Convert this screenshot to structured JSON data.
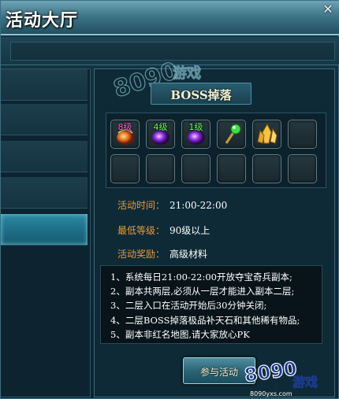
{
  "window": {
    "title": "活动大厅",
    "close_glyph": "✕"
  },
  "boss_drop": {
    "title": "BOSS掉落",
    "items": [
      {
        "level_label": "8级",
        "level_color": "#ff66cc",
        "icon": "orange-gem-icon"
      },
      {
        "level_label": "4级",
        "level_color": "#66ff66",
        "icon": "purple-gem-icon"
      },
      {
        "level_label": "1级",
        "level_color": "#66ff66",
        "icon": "purple-gem-icon"
      },
      {
        "level_label": "",
        "level_color": "",
        "icon": "green-staff-icon"
      },
      {
        "level_label": "",
        "level_color": "",
        "icon": "gold-crystal-icon"
      },
      {
        "level_label": "",
        "level_color": "",
        "icon": ""
      }
    ],
    "empty_slots": 6
  },
  "info": {
    "time_label": "活动时间：",
    "time_value": "21:00-22:00",
    "level_label": "最低等级：",
    "level_value": "90级以上",
    "reward_label": "活动奖励：",
    "reward_value": "高级材料"
  },
  "rules": [
    "1、系统每日21:00-22:00开放夺宝奇兵副本;",
    "2、副本共两层,必须从一层才能进入副本二层;",
    "3、二层入口在活动开始后30分钟关闭;",
    "4、二层BOSS掉落极品补天石和其他稀有物品;",
    "5、副本非红名地图,请大家放心PK"
  ],
  "join_button": {
    "label": "参与活动"
  },
  "watermark": {
    "number": "8090",
    "brand": "游戏",
    "url": "8090yxs.com"
  },
  "colors": {
    "label": "#e79a3c",
    "value": "#ffffff",
    "accent": "#2e8aa3"
  }
}
